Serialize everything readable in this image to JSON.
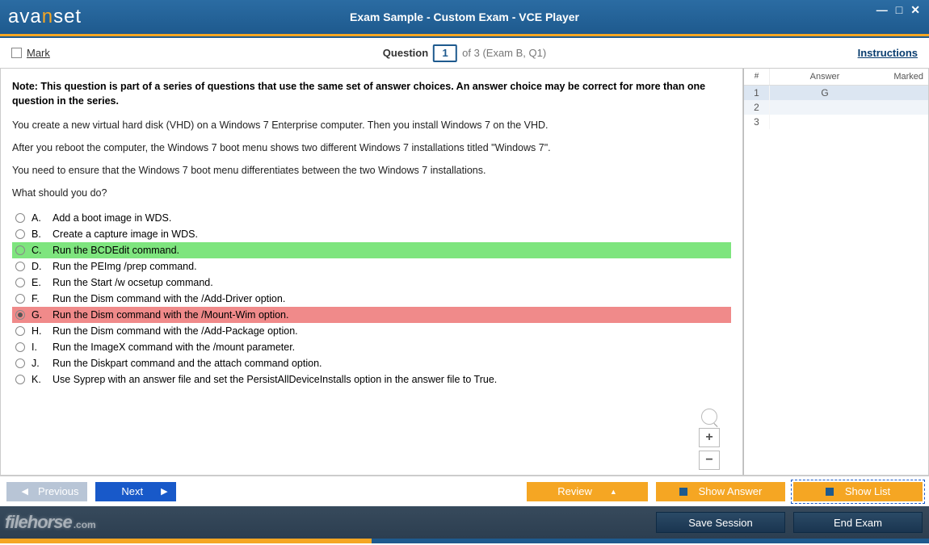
{
  "title": "Exam Sample - Custom Exam - VCE Player",
  "logo": {
    "p1": "ava",
    "p2": "n",
    "p3": "set"
  },
  "header": {
    "mark_label": "Mark",
    "question_label": "Question",
    "question_num": "1",
    "of_text": "of 3 (Exam B, Q1)",
    "instructions": "Instructions"
  },
  "note": "Note: This question is part of a series of questions that use the same set of answer choices. An answer choice may be correct for more than one question in the series.",
  "paras": [
    "You create a new virtual hard disk (VHD) on a Windows 7 Enterprise computer. Then you install Windows 7 on the VHD.",
    "After you reboot the computer, the Windows 7 boot menu shows two different Windows 7 installations titled \"Windows 7\".",
    "You need to ensure that the Windows 7 boot menu differentiates between the two Windows 7 installations.",
    "What should you do?"
  ],
  "options": [
    {
      "l": "A.",
      "t": "Add a boot image in WDS.",
      "state": ""
    },
    {
      "l": "B.",
      "t": "Create a capture image in WDS.",
      "state": ""
    },
    {
      "l": "C.",
      "t": "Run the BCDEdit command.",
      "state": "correct"
    },
    {
      "l": "D.",
      "t": "Run the PEImg /prep command.",
      "state": ""
    },
    {
      "l": "E.",
      "t": "Run the Start /w ocsetup command.",
      "state": ""
    },
    {
      "l": "F.",
      "t": "Run the Dism command with the /Add-Driver option.",
      "state": ""
    },
    {
      "l": "G.",
      "t": "Run the Dism command with the /Mount-Wim option.",
      "state": "wrong"
    },
    {
      "l": "H.",
      "t": "Run the Dism command with the /Add-Package option.",
      "state": ""
    },
    {
      "l": "I.",
      "t": "Run the ImageX command with the /mount parameter.",
      "state": ""
    },
    {
      "l": "J.",
      "t": "Run the Diskpart command and the attach command option.",
      "state": ""
    },
    {
      "l": "K.",
      "t": "Use Syprep with an answer file and set the PersistAllDeviceInstalls option in the answer file to True.",
      "state": ""
    }
  ],
  "side": {
    "cols": {
      "num": "#",
      "answer": "Answer",
      "marked": "Marked"
    },
    "rows": [
      {
        "n": "1",
        "a": "G",
        "m": ""
      },
      {
        "n": "2",
        "a": "",
        "m": ""
      },
      {
        "n": "3",
        "a": "",
        "m": ""
      }
    ]
  },
  "buttons": {
    "prev": "Previous",
    "next": "Next",
    "review": "Review",
    "show_answer": "Show Answer",
    "show_list": "Show List",
    "save_session": "Save Session",
    "end_exam": "End Exam"
  },
  "watermark": {
    "a": "filehorse",
    "b": ".com"
  }
}
